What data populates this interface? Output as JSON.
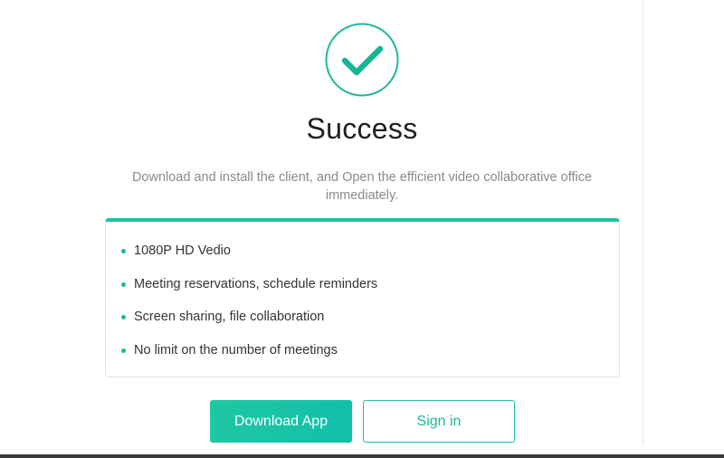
{
  "colors": {
    "accent": "#1cc3a2",
    "title_text": "#1f1f1f",
    "subtitle_text": "#8a8a8a",
    "body_text": "#333333"
  },
  "status": {
    "icon": "check-circle-icon",
    "title": "Success",
    "description": "Download and install the client, and Open the efficient video collaborative office immediately."
  },
  "features": {
    "items": [
      {
        "label": "1080P HD Vedio"
      },
      {
        "label": "Meeting reservations, schedule reminders"
      },
      {
        "label": "Screen sharing, file collaboration"
      },
      {
        "label": "No limit on the number of meetings"
      }
    ]
  },
  "actions": {
    "download_label": "Download App",
    "signin_label": "Sign in"
  }
}
